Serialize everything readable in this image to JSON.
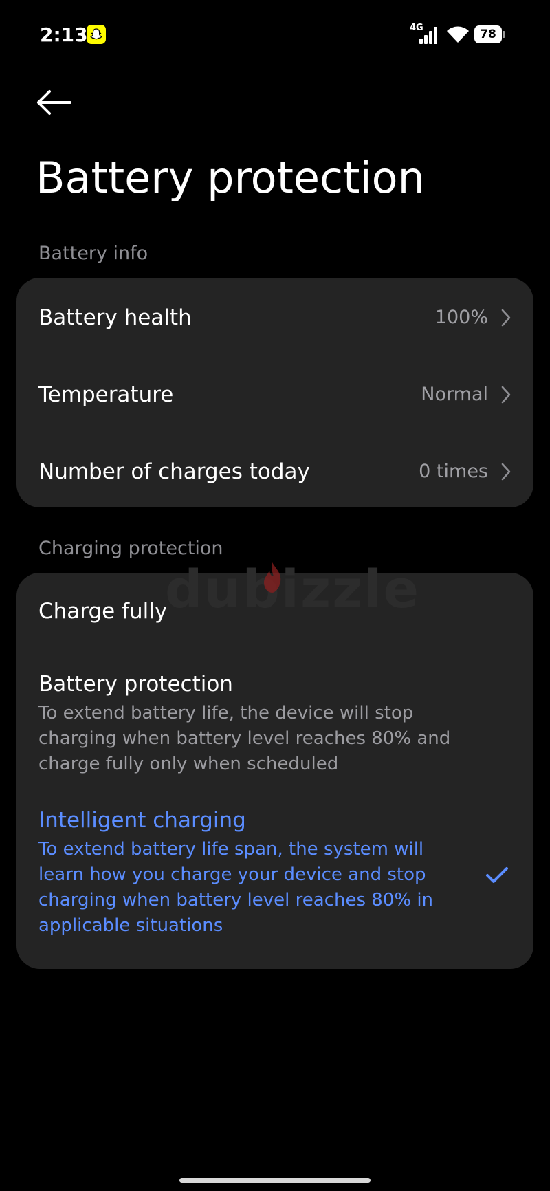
{
  "status_bar": {
    "time": "2:13",
    "network_type": "4G",
    "battery_level": "78"
  },
  "header": {
    "title": "Battery protection"
  },
  "battery_info": {
    "section_label": "Battery info",
    "rows": [
      {
        "label": "Battery health",
        "value": "100%"
      },
      {
        "label": "Temperature",
        "value": "Normal"
      },
      {
        "label": "Number of charges today",
        "value": "0 times"
      }
    ]
  },
  "charging_protection": {
    "section_label": "Charging protection",
    "options": [
      {
        "title": "Charge fully",
        "description": "",
        "selected": false
      },
      {
        "title": "Battery protection",
        "description": "To extend battery life, the device will stop charging when battery level reaches 80% and charge fully only when scheduled",
        "selected": false
      },
      {
        "title": "Intelligent charging",
        "description": "To extend battery life span, the system will learn how you charge your device and stop charging when battery level reaches 80% in applicable situations",
        "selected": true
      }
    ]
  },
  "watermark": "dubizzle",
  "colors": {
    "background": "#000000",
    "card": "#242424",
    "accent": "#5b8dff",
    "secondary_text": "#8e8e93"
  },
  "icons": [
    "back-arrow-icon",
    "chevron-right-icon",
    "check-icon",
    "wifi-icon",
    "signal-icon",
    "battery-icon",
    "snapchat-icon"
  ]
}
